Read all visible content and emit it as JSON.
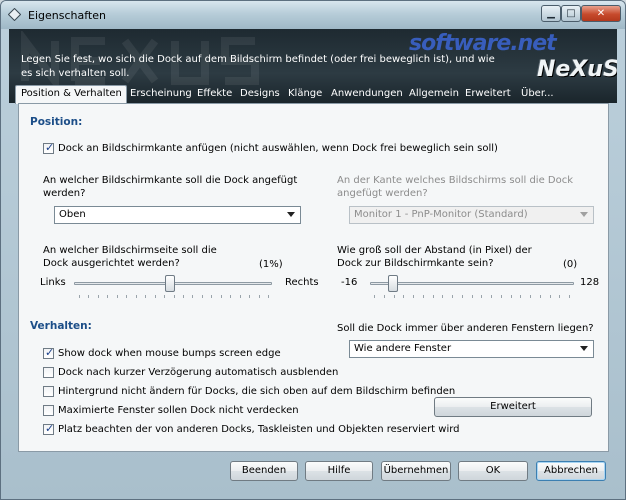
{
  "window": {
    "title": "Eigenschaften"
  },
  "header": {
    "description": "Legen Sie fest, wo sich die Dock auf dem Bildschirm befindet (oder frei beweglich ist), und wie es sich verhalten soll.",
    "watermark": "software.net",
    "logo": "NeXuS"
  },
  "tabs": [
    "Position & Verhalten",
    "Erscheinung",
    "Effekte",
    "Designs",
    "Klänge",
    "Anwendungen",
    "Allgemein",
    "Erweitert",
    "Über..."
  ],
  "position": {
    "section_title": "Position:",
    "attach_edge_label": "Dock an Bildschirmkante anfügen (nicht auswählen, wenn Dock frei beweglich sein soll)",
    "attach_edge_checked": true,
    "edge_question": "An welcher Bildschirmkante soll die Dock angefügt werden?",
    "edge_value": "Oben",
    "monitor_question": "An der Kante welches Bildschirms soll die Dock angefügt werden?",
    "monitor_value": "Monitor 1 - PnP-Monitor (Standard)",
    "align_question": "An welcher Bildschirmseite soll die Dock ausgerichtet werden?",
    "align_value": "(1%)",
    "align_min_label": "Links",
    "align_max_label": "Rechts",
    "align_fraction": 0.01,
    "distance_question": "Wie groß soll der Abstand (in Pixel) der Dock zur Bildschirmkante sein?",
    "distance_value": "(0)",
    "distance_min": "-16",
    "distance_max": "128",
    "distance_current": 0
  },
  "behavior": {
    "section_title": "Verhalten:",
    "options": [
      {
        "label": "Show dock when mouse bumps screen edge",
        "checked": true
      },
      {
        "label": "Dock nach kurzer Verzögerung automatisch ausblenden",
        "checked": false
      },
      {
        "label": "Hintergrund nicht ändern für Docks, die sich oben auf dem Bildschirm befinden",
        "checked": false
      },
      {
        "label": "Maximierte Fenster sollen Dock nicht verdecken",
        "checked": false
      },
      {
        "label": "Platz beachten der von anderen Docks, Taskleisten und Objekten reserviert wird",
        "checked": true
      }
    ],
    "on_top_question": "Soll die Dock immer über anderen Fenstern liegen?",
    "on_top_value": "Wie andere Fenster",
    "advanced_button": "Erweitert"
  },
  "footer": {
    "beenden": "Beenden",
    "hilfe": "Hilfe",
    "uebernehmen": "Übernehmen",
    "ok": "OK",
    "abbrechen": "Abbrechen"
  },
  "colors": {
    "section_title": "#1c4e88",
    "header_bg": "#1e2a31",
    "close_button": "#c74a2c"
  }
}
